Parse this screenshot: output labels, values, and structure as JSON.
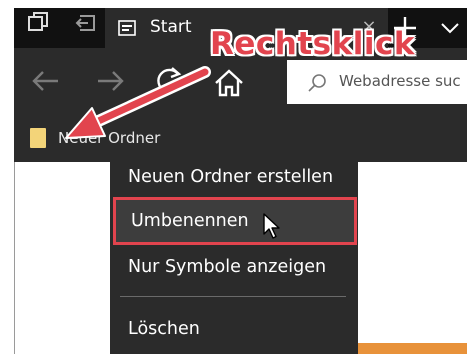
{
  "tab": {
    "title": "Start",
    "close_glyph": "×",
    "icon": "page-icon"
  },
  "address_bar": {
    "placeholder": "Webadresse suc"
  },
  "favorites_bar": {
    "folder_label": "Neuer Ordner"
  },
  "context_menu": {
    "items": [
      "Neuen Ordner erstellen",
      "Umbenennen",
      "Nur Symbole anzeigen",
      "Löschen"
    ],
    "highlighted": "Umbenennen"
  },
  "annotation": {
    "text": "Rechtsklick"
  },
  "colors": {
    "annotation_red": "#e2444e",
    "chrome_dark": "#2b2b2b",
    "tab_strip": "#111111",
    "folder_yellow": "#f3d479"
  },
  "icons": [
    "tab-switcher-icon",
    "set-aside-tabs-icon",
    "page-icon",
    "close-icon",
    "plus-icon",
    "chevron-down-icon",
    "back-arrow-icon",
    "forward-arrow-icon",
    "refresh-icon",
    "home-icon",
    "search-icon",
    "folder-icon",
    "mouse-cursor-icon"
  ]
}
